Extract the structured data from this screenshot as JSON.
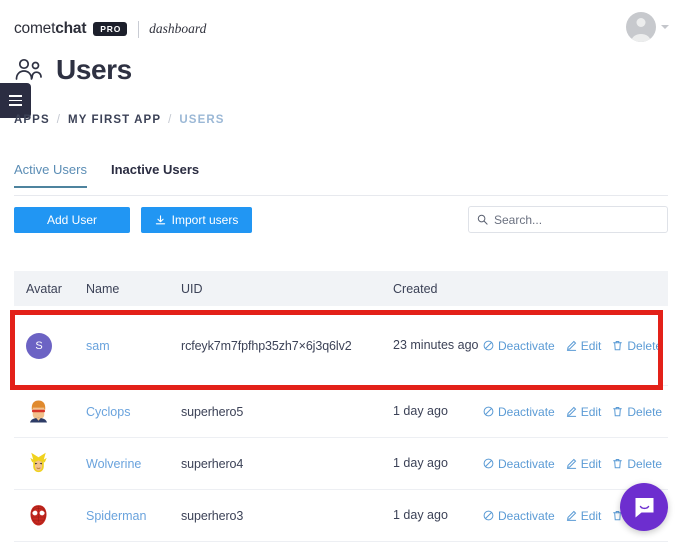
{
  "brand": {
    "name_light": "comet",
    "name_bold": "chat",
    "badge": "PRO",
    "product": "dashboard"
  },
  "header": {
    "title": "Users",
    "users_icon": "users-icon",
    "avatar_icon": "user-avatar-icon",
    "caret_icon": "chevron-down-icon"
  },
  "menu": {
    "hamburger_icon": "hamburger-icon"
  },
  "breadcrumb": {
    "items": [
      {
        "label": "APPS",
        "active": false
      },
      {
        "label": "MY FIRST APP",
        "active": false
      },
      {
        "label": "USERS",
        "active": true
      }
    ],
    "separator": "/"
  },
  "tabs": [
    {
      "label": "Active Users",
      "active": true
    },
    {
      "label": "Inactive Users",
      "active": false
    }
  ],
  "toolbar": {
    "add_user_label": "Add User",
    "import_users_label": "Import users",
    "import_icon": "download-icon",
    "accent_color": "#2196f3"
  },
  "search": {
    "placeholder": "Search...",
    "value": "",
    "icon": "search-icon"
  },
  "table": {
    "columns": [
      "Avatar",
      "Name",
      "UID",
      "Created"
    ],
    "rows": [
      {
        "avatar_type": "initial",
        "avatar_initial": "S",
        "avatar_color": "#6c63c4",
        "name": "sam",
        "uid": "rcfeyk7m7fpfhp35zh7×6j3q6lv2",
        "created": "23 minutes ago",
        "highlighted": true
      },
      {
        "avatar_type": "image",
        "avatar_art": "cyclops",
        "name": "Cyclops",
        "uid": "superhero5",
        "created": "1 day ago",
        "highlighted": false
      },
      {
        "avatar_type": "image",
        "avatar_art": "wolverine",
        "name": "Wolverine",
        "uid": "superhero4",
        "created": "1 day ago",
        "highlighted": false
      },
      {
        "avatar_type": "image",
        "avatar_art": "spiderman",
        "name": "Spiderman",
        "uid": "superhero3",
        "created": "1 day ago",
        "highlighted": false
      }
    ],
    "actions": {
      "deactivate_label": "Deactivate",
      "deactivate_icon": "ban-icon",
      "edit_label": "Edit",
      "edit_icon": "pencil-icon",
      "delete_label": "Delete",
      "delete_icon": "trash-icon"
    }
  },
  "annotation": {
    "highlight_color": "#e32119"
  },
  "chat_widget": {
    "icon": "chat-bubble-icon",
    "color": "#6d2ecf"
  }
}
